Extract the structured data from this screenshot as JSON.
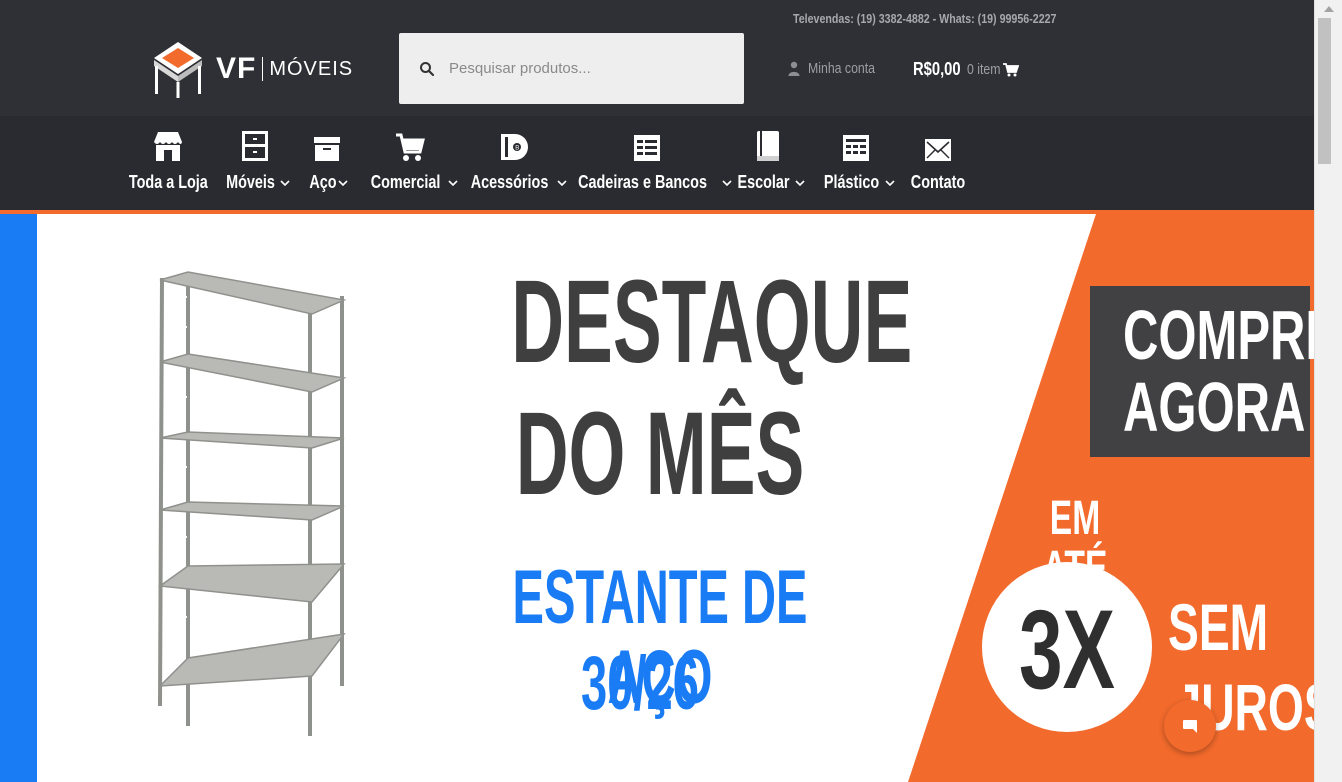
{
  "header": {
    "topline": "Televendas: (19) 3382-4882 - Whats: (19) 99956-2227",
    "logo": {
      "primary": "VF",
      "secondary": "MÓVEIS"
    },
    "search": {
      "placeholder": "Pesquisar produtos..."
    },
    "account": {
      "label": "Minha conta"
    },
    "cart": {
      "total": "R$0,00",
      "count": "0 item"
    }
  },
  "nav": {
    "items": [
      {
        "label": "Toda a Loja",
        "icon": "store-icon",
        "has_dropdown": false
      },
      {
        "label": "Móveis",
        "icon": "cabinet-icon",
        "has_dropdown": true
      },
      {
        "label": "Aço",
        "icon": "drawer-icon",
        "has_dropdown": true
      },
      {
        "label": "Comercial",
        "icon": "cart-icon",
        "has_dropdown": true
      },
      {
        "label": "Acessórios",
        "icon": "accessory-icon",
        "has_dropdown": true
      },
      {
        "label": "Cadeiras e Bancos",
        "icon": "chair-icon",
        "has_dropdown": true
      },
      {
        "label": "Escolar",
        "icon": "book-icon",
        "has_dropdown": true
      },
      {
        "label": "Plástico",
        "icon": "table-icon",
        "has_dropdown": true
      },
      {
        "label": "Contato",
        "icon": "mail-icon",
        "has_dropdown": false
      }
    ]
  },
  "banner": {
    "headline_line1": "DESTAQUE",
    "headline_line2": "DO MÊS",
    "product_line1": "ESTANTE DE AÇO",
    "product_line2": "30/26",
    "cta_line1": "COMPRE",
    "cta_line2": "AGORA",
    "installment_prefix": "EM ATÉ",
    "installment_number": "3X",
    "installment_suffix1": "SEM",
    "installment_suffix2": "JUROS"
  },
  "colors": {
    "header_bg": "#2f3035",
    "accent_orange": "#f26a2c",
    "accent_blue": "#1a7cf5",
    "dark_text": "#3f3f3f"
  },
  "chat": {
    "icon": "chat-icon"
  }
}
